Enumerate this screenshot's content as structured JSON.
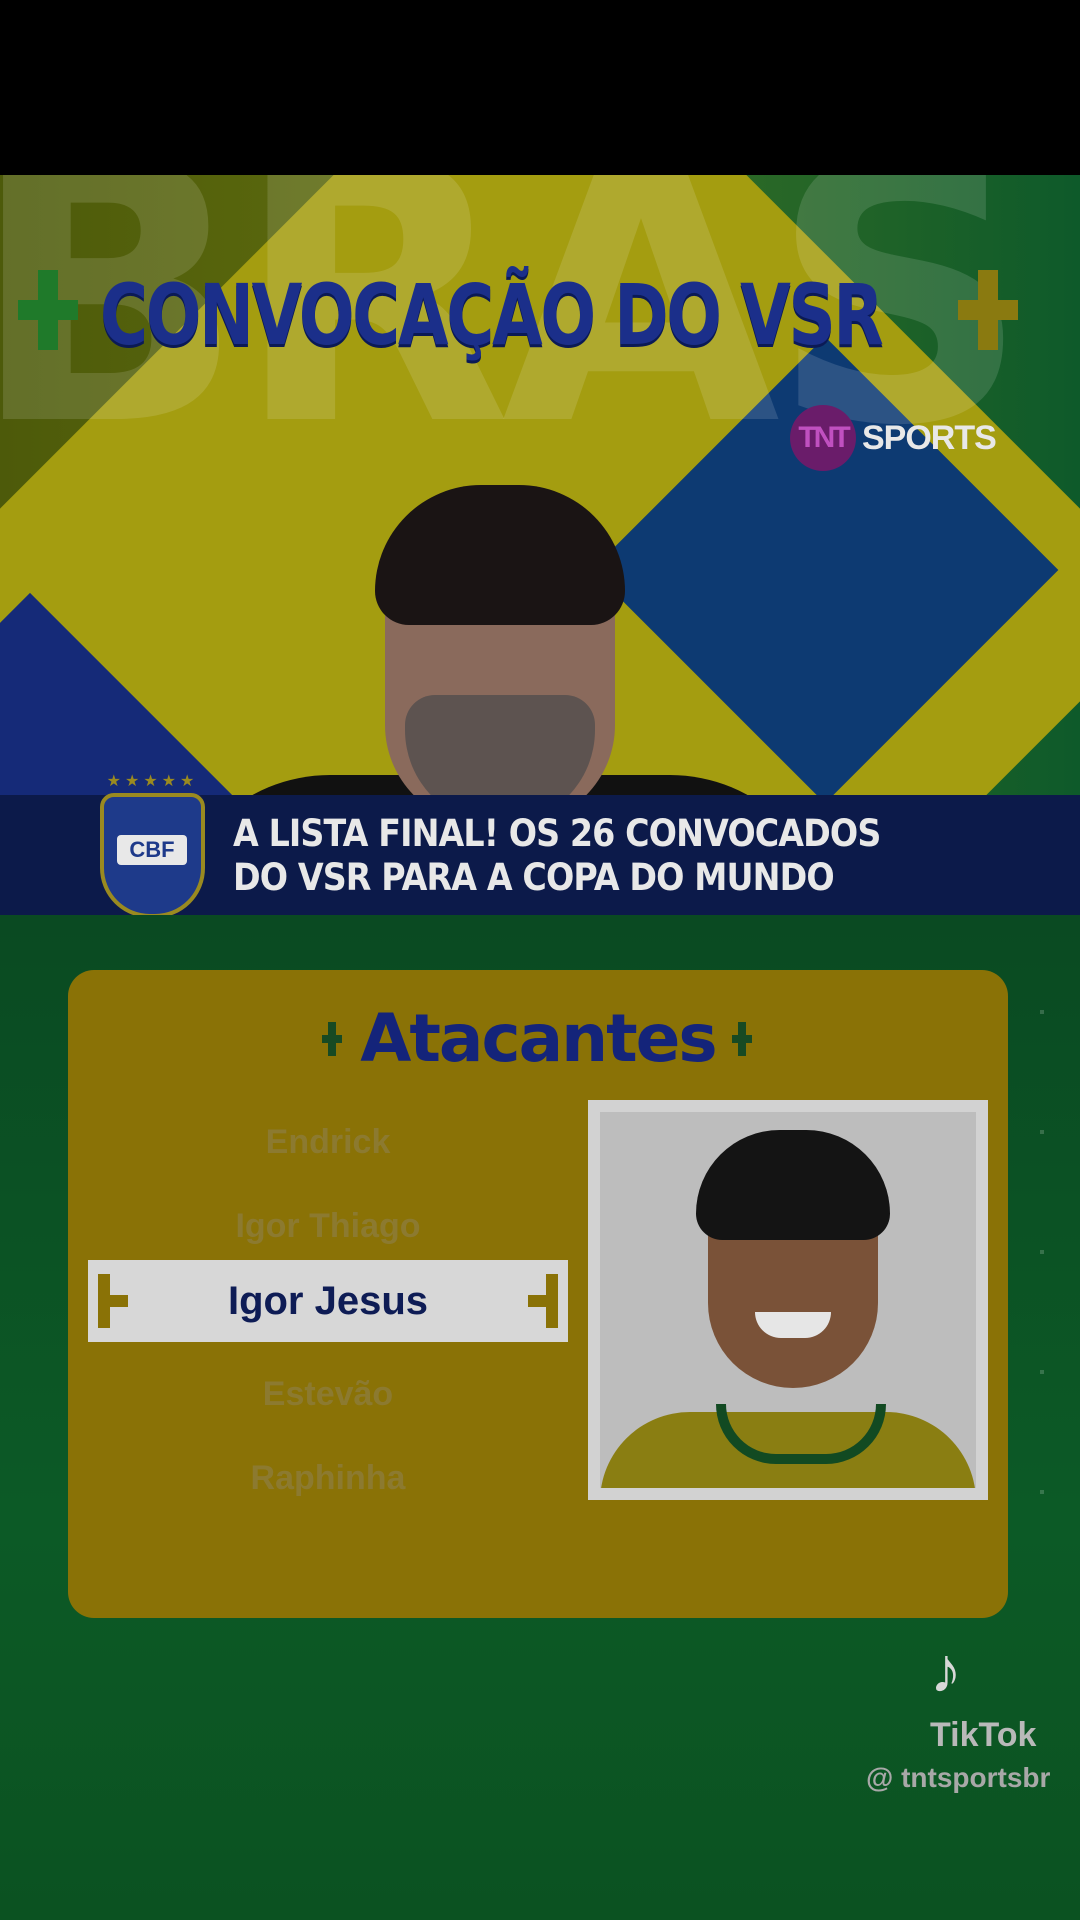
{
  "broadcast": {
    "title": "CONVOCAÇÃO DO VSR",
    "ghost_text": "BRAS",
    "channel_logo": "TNT",
    "channel_name": "SPORTS"
  },
  "lower_third": {
    "crest_label": "CBF",
    "line1": "A LISTA FINAL! OS 26 CONVOCADOS",
    "line2": "DO VSR PARA A COPA DO MUNDO"
  },
  "card": {
    "title": "Atacantes",
    "players": [
      {
        "name": "Endrick"
      },
      {
        "name": "Igor Thiago"
      },
      {
        "name": "Igor Jesus",
        "selected": true
      },
      {
        "name": "Estevão"
      },
      {
        "name": "Raphinha"
      }
    ],
    "selected_player": "Igor Jesus",
    "photo_icon": "player-portrait"
  },
  "watermark": {
    "app": "TikTok",
    "handle": "@ tntsportsbr"
  },
  "colors": {
    "title_blue": "#1b2f8a",
    "card_yellow": "#8a7206",
    "field_green": "#0c5a26",
    "lower_navy": "#0c1a4a"
  }
}
